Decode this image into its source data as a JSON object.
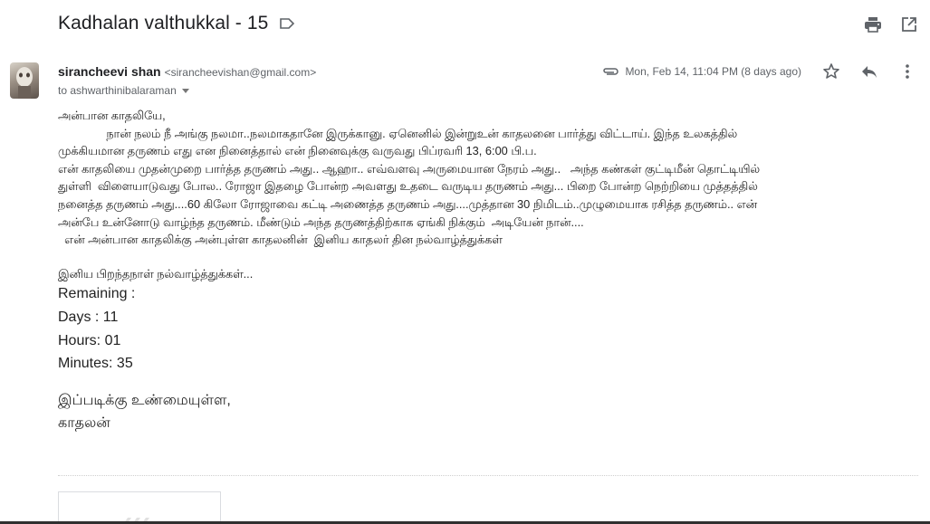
{
  "email": {
    "subject": "Kadhalan valthukkal - 15",
    "sender_name": "sirancheevi shan",
    "sender_email": "<sirancheevishan@gmail.com>",
    "to_line": "to ashwarthinibalaraman",
    "date": "Mon, Feb 14, 11:04 PM (8 days ago)"
  },
  "body": {
    "greeting": "அன்பான காதலியே,",
    "paragraph_1": "               நான் நலம் நீ அங்கு நலமா..நலமாகதானே இருக்கானு. ஏனெனில் இன்றுஉன் காதலனை பார்த்து விட்டாய். இந்த உலகத்தில்\nமுக்கியமான தருணம் எது என நினைத்தால் என் நினைவுக்கு வருவது பிப்ரவரி 13, 6:00 பி.ப.\nஎன் காதலியை முதன்முறை பார்த்த தருணம் அது.. ஆஹா.. எவ்வளவு அருமையான நேரம் அது..   அந்த கண்கள் குட்டிமீன் தொட்டியில்\nதுள்ளி  விளையாடுவது போல.. ரோஜா இதழை போன்ற அவளது உதடை வருடிய தருணம் அது... பிறை போன்ற நெற்றியை முத்தத்தில்\nநனைத்த தருணம் அது....60 கிலோ ரோஜாவை கட்டி அணைத்த தருணம் அது....முத்தான 30 நிமிடம்..முழுமையாக ரசித்த தருணம்.. என்\nஅன்பே உன்னோடு வாழ்ந்த தருணம். மீண்டும் அந்த தருணத்திற்காக ஏங்கி நிக்கும்  அடியேன் நான்....\n  என் அன்பான காதலிக்கு அன்புள்ள காதலனின்  இனிய காதலர் தின நல்வாழ்த்துக்கள்",
    "birthday_wish": "இனிய பிறந்தநாள் நல்வாழ்த்துக்கள்...",
    "remaining_label": "Remaining :",
    "days": "Days : 11",
    "hours": "Hours: 01",
    "minutes": "Minutes: 35",
    "closing_1": "இப்படிக்கு உண்மையுள்ள,",
    "closing_2": "காதலன்"
  },
  "icons": {
    "label": "label-outline-icon",
    "print": "print-icon",
    "new_window": "open-in-new-icon",
    "attachment": "attachment-icon",
    "star": "star-icon",
    "reply": "reply-icon",
    "more": "more-vert-icon"
  },
  "colors": {
    "text": "#222222",
    "meta": "#5f6368",
    "icon": "#5f6368"
  }
}
